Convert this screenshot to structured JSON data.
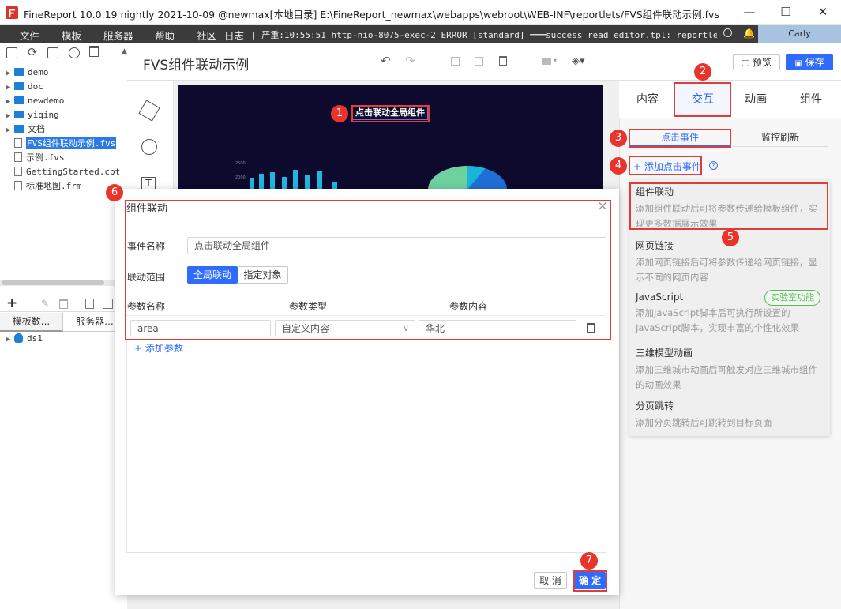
{
  "window": {
    "title": "FineReport 10.0.19 nightly 2021-10-09 @newmax[本地目录]    E:\\FineReport_newmax\\webapps\\webroot\\WEB-INF\\reportlets/FVS组件联动示例.fvs",
    "minimize": "—",
    "maximize": "☐",
    "close": "✕"
  },
  "menu": {
    "items": [
      "文件",
      "模板",
      "服务器",
      "帮助",
      "社区"
    ],
    "log_label": "日志",
    "log_text": "| 严重:10:55:51 http-nio-8075-exec-2 ERROR [standard] ═══success read editor.tpl: reportle...",
    "user": "Carly"
  },
  "tree": {
    "items": [
      {
        "label": "demo",
        "type": "folder"
      },
      {
        "label": "doc",
        "type": "folder"
      },
      {
        "label": "newdemo",
        "type": "folder"
      },
      {
        "label": "yiqing",
        "type": "folder"
      },
      {
        "label": "文档",
        "type": "folder"
      },
      {
        "label": "FVS组件联动示例.fvs",
        "type": "file",
        "selected": true
      },
      {
        "label": "示例.fvs",
        "type": "file"
      },
      {
        "label": "GettingStarted.cpt",
        "type": "file"
      },
      {
        "label": "标准地图.frm",
        "type": "file"
      }
    ]
  },
  "datasets": {
    "tabs": [
      "模板数...",
      "服务器..."
    ],
    "items": [
      "ds1"
    ]
  },
  "designer": {
    "title": "FVS组件联动示例",
    "canvas_title": "点击联动全局组件",
    "axis_ticks": [
      "2500",
      "2000"
    ]
  },
  "toolbar": {
    "preview": "预览",
    "save": "保存"
  },
  "right": {
    "tabs": [
      "内容",
      "交互",
      "动画",
      "组件"
    ],
    "subtabs": [
      "点击事件",
      "监控刷新"
    ],
    "add_event": "+ 添加点击事件",
    "events": [
      {
        "title": "组件联动",
        "desc": "添加组件联动后可将参数传递给模板组件，实现更多数据展示效果",
        "tag": ""
      },
      {
        "title": "网页链接",
        "desc": "添加网页链接后可将参数传递给网页链接，显示不同的网页内容",
        "tag": ""
      },
      {
        "title": "JavaScript",
        "desc": "添加JavaScript脚本后可执行所设置的JavaScript脚本，实现丰富的个性化效果",
        "tag": "实验室功能"
      },
      {
        "title": "三维模型动画",
        "desc": "添加三维城市动画后可触发对应三维城市组件的动画效果",
        "tag": ""
      },
      {
        "title": "分页跳转",
        "desc": "添加分页跳转后可跳转到目标页面",
        "tag": ""
      }
    ]
  },
  "dialog": {
    "title": "组件联动",
    "close": "×",
    "event_name_label": "事件名称",
    "event_name_value": "点击联动全局组件",
    "scope_label": "联动范围",
    "scope_options": [
      "全局联动",
      "指定对象"
    ],
    "col_headers": [
      "参数名称",
      "参数类型",
      "参数内容"
    ],
    "param": {
      "name": "area",
      "type": "自定义内容",
      "content": "华北"
    },
    "add_param": "+ 添加参数",
    "cancel": "取 消",
    "ok": "确 定"
  },
  "badges": [
    "1",
    "2",
    "3",
    "4",
    "5",
    "6",
    "7"
  ],
  "colors": {
    "accent": "#2f6bff",
    "annotation_red": "#e03c3c",
    "menubar": "#3b3b3b",
    "canvas_bg": "#0d0a2e",
    "lab_tag": "#5db85b"
  }
}
